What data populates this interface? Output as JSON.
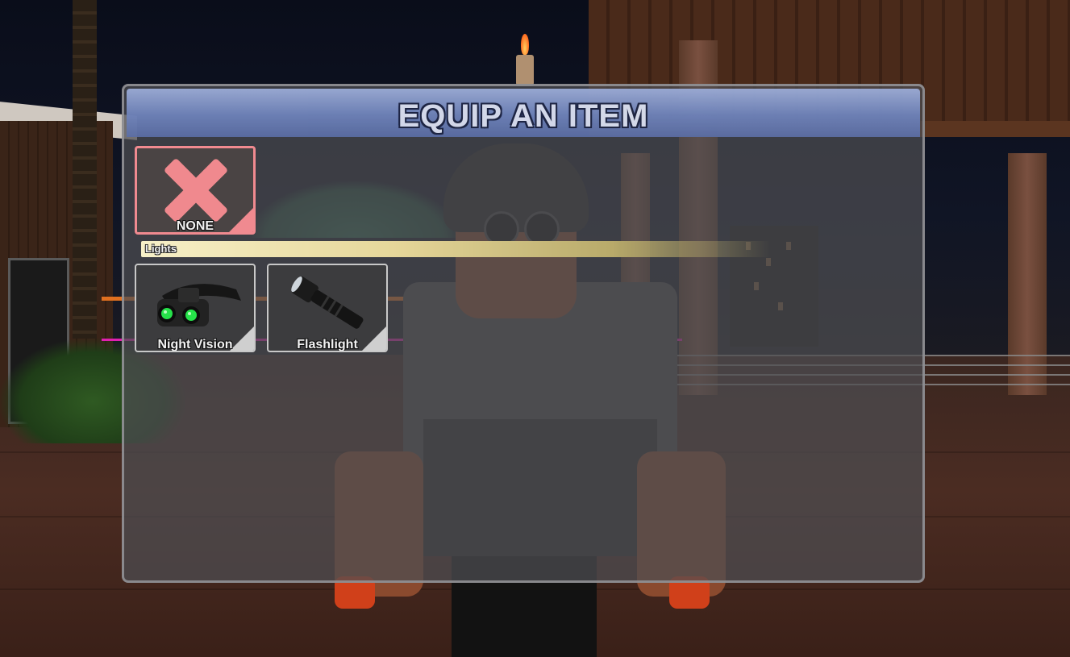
{
  "panel": {
    "title": "EQUIP AN ITEM"
  },
  "items": {
    "none": {
      "label": "NONE",
      "icon": "close-x-icon",
      "accent": "#f08a90"
    },
    "sections": [
      {
        "label": "Lights",
        "items": [
          {
            "label": "Night Vision",
            "icon": "night-vision-goggles-icon"
          },
          {
            "label": "Flashlight",
            "icon": "flashlight-icon"
          }
        ]
      }
    ]
  },
  "colors": {
    "title_bar": "#6f84bd",
    "panel_bg": "#4e4e52",
    "section_bar": "#e6d79a"
  }
}
